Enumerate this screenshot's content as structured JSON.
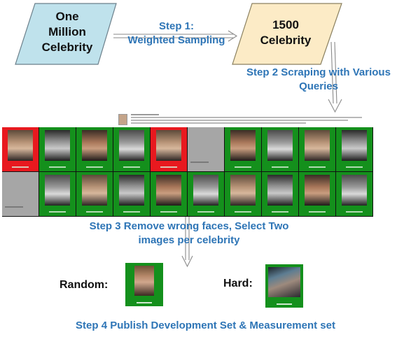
{
  "colors": {
    "step_text": "#2e75b6",
    "node_one_million": "#bfe2ec",
    "node_1500": "#fcebc6",
    "cell_green": "#14901c",
    "cell_red": "#e8191f",
    "cell_gray": "#a6a6a6"
  },
  "nodes": {
    "one_million": "One\nMillion\nCelebrity",
    "celeb_1500": "1500\nCelebrity"
  },
  "steps": {
    "step1": "Step 1:\nWeighted Sampling",
    "step2": "Step 2 Scraping with Various\nQueries",
    "step3": "Step 3 Remove wrong faces, Select Two\nimages per celebrity",
    "step4": "Step 4 Publish Development Set & Measurement set"
  },
  "samples": {
    "random_label": "Random:",
    "hard_label": "Hard:"
  },
  "search_result": {
    "icon": "search-result-thumbnail-icon"
  },
  "grid": {
    "rows": [
      [
        "red",
        "green",
        "green",
        "green",
        "red",
        "gray",
        "green",
        "green",
        "green",
        "green"
      ],
      [
        "gray",
        "green",
        "green",
        "green",
        "green",
        "green",
        "green",
        "green",
        "green",
        "green"
      ]
    ]
  }
}
